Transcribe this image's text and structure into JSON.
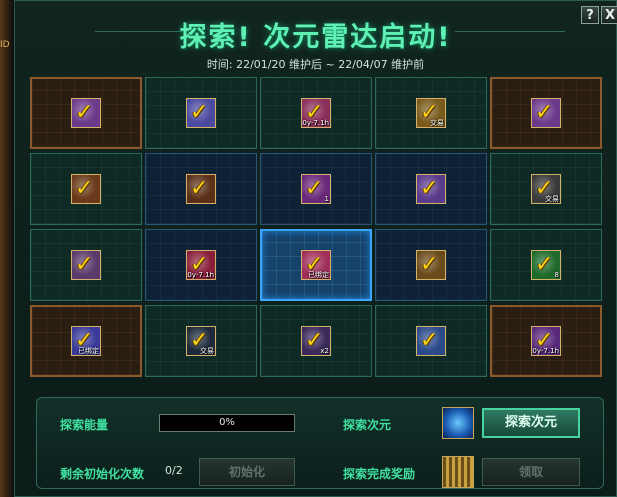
{
  "window": {
    "title": "探索! 次元雷达启动!",
    "subtitle": "时间: 22/01/20 维护后 ~ 22/04/07 维护前",
    "help_label": "?",
    "close_label": "X",
    "left_edge_text": "ID"
  },
  "colors": {
    "accent": "#3fe0a0",
    "title": "#5ff0b4",
    "check": "#ffd21a",
    "active_cell": "#3aa6ff",
    "corner_cell": "#8a5a2c"
  },
  "grid": {
    "cells": [
      {
        "style": "orange",
        "icon": "purple-box-check-icon",
        "bg": "#6b3a8a",
        "tag": ""
      },
      {
        "style": "green",
        "icon": "blue-crystal-check-icon",
        "bg": "#4a4aa0",
        "tag": ""
      },
      {
        "style": "green",
        "icon": "pink-chest-check-icon",
        "bg": "#8a2e5a",
        "tag": "L0y-7.1h"
      },
      {
        "style": "green",
        "icon": "gold-item-check-icon",
        "bg": "#7a5a1a",
        "tag": "交易"
      },
      {
        "style": "orange",
        "icon": "purple-box-check-icon",
        "bg": "#6b3a8a",
        "tag": ""
      },
      {
        "style": "green",
        "icon": "brown-item-check-icon",
        "bg": "#6a3a1a",
        "tag": ""
      },
      {
        "style": "blue",
        "icon": "brown-chest-check-icon",
        "bg": "#5a3018",
        "tag": ""
      },
      {
        "style": "blue",
        "icon": "purple-orb-check-icon",
        "bg": "#6a2a7a",
        "tag": "1"
      },
      {
        "style": "blue",
        "icon": "purple-gem-check-icon",
        "bg": "#5a3a8a",
        "tag": ""
      },
      {
        "style": "green",
        "icon": "gray-item-check-icon",
        "bg": "#3a3a3a",
        "tag": "交易"
      },
      {
        "style": "green",
        "icon": "purple-scroll-check-icon",
        "bg": "#5a3a6a",
        "tag": ""
      },
      {
        "style": "blue",
        "icon": "red-chest-check-icon",
        "bg": "#8a1e3a",
        "tag": "L0y-7.1h"
      },
      {
        "style": "active",
        "icon": "pink-box-check-icon",
        "bg": "#a0305a",
        "tag": "已绑定"
      },
      {
        "style": "blue",
        "icon": "gold-card-check-icon",
        "bg": "#6a4a1a",
        "tag": ""
      },
      {
        "style": "green",
        "icon": "green-potion-check-icon",
        "bg": "#1e6a2a",
        "tag": "8"
      },
      {
        "style": "orange",
        "icon": "blue-box-check-icon",
        "bg": "#3a3a9a",
        "tag": "已绑定"
      },
      {
        "style": "green",
        "icon": "dark-blade-check-icon",
        "bg": "#1e2a3a",
        "tag": "交易"
      },
      {
        "style": "green",
        "icon": "purple-card-check-icon",
        "bg": "#3a2a5a",
        "tag": "x2"
      },
      {
        "style": "green",
        "icon": "blue-gem-check-icon",
        "bg": "#2a4a8a",
        "tag": ""
      },
      {
        "style": "orange",
        "icon": "purple-chest-check-icon",
        "bg": "#5a2a7a",
        "tag": "L0y-7.1h"
      }
    ]
  },
  "panel": {
    "energy_label": "探索能量",
    "energy_value": "0%",
    "energy_fraction": 0,
    "dimension_label": "探索次元",
    "explore_button": "探索次元",
    "reset_label": "剩余初始化次数",
    "reset_count": "0/2",
    "reset_button": "初始化",
    "reward_label": "探索完成奖励",
    "claim_button": "领取",
    "dimension_icon": "blue-crystal-icon",
    "reward_icon": "gold-maze-icon"
  }
}
